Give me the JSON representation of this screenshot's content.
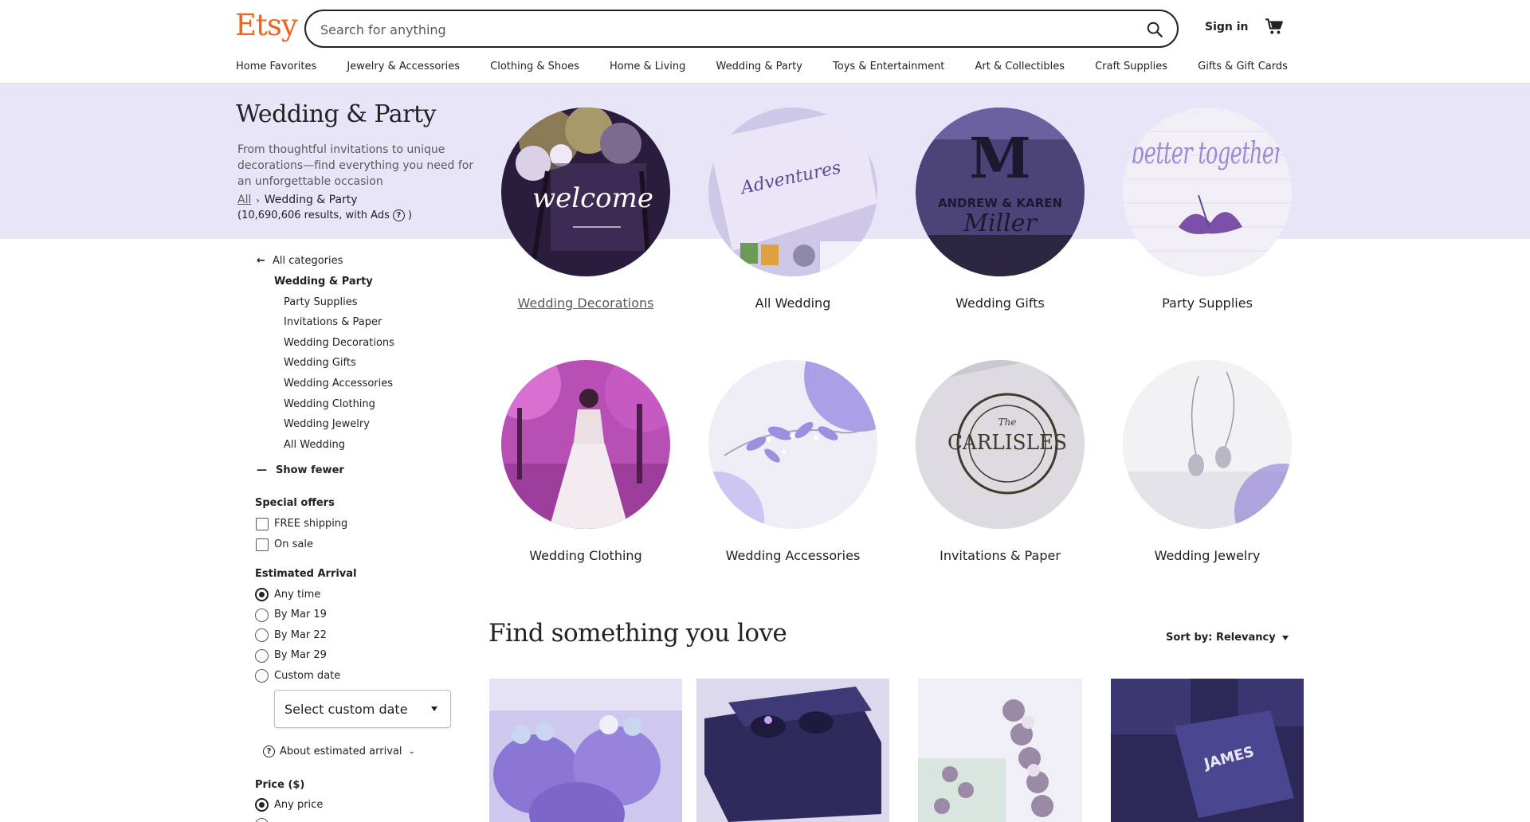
{
  "header": {
    "logo": "Etsy",
    "search_placeholder": "Search for anything",
    "sign_in": "Sign in",
    "cart_icon": "cart-icon",
    "search_icon": "search-icon"
  },
  "category_nav": [
    "Home Favorites",
    "Jewelry & Accessories",
    "Clothing & Shoes",
    "Home & Living",
    "Wedding & Party",
    "Toys & Entertainment",
    "Art & Collectibles",
    "Craft Supplies",
    "Gifts & Gift Cards"
  ],
  "hero": {
    "title": "Wedding & Party",
    "description": "From thoughtful invitations to unique decorations—find everything you need for an unforgettable occasion",
    "breadcrumb_root": "All",
    "breadcrumb_current": "Wedding & Party",
    "results_text": "(10,690,606 results, with Ads",
    "results_close": ")",
    "help_glyph": "?",
    "background": "#e8e5f8"
  },
  "categories": [
    {
      "label": "Wedding Decorations",
      "image_text": "welcome"
    },
    {
      "label": "All Wedding",
      "image_text": "Adventures"
    },
    {
      "label": "Wedding Gifts",
      "image_text": "Miller"
    },
    {
      "label": "Party Supplies",
      "image_text": "better together"
    },
    {
      "label": "Wedding Clothing",
      "image_text": ""
    },
    {
      "label": "Wedding Accessories",
      "image_text": ""
    },
    {
      "label": "Invitations & Paper",
      "image_text": "CARLISLES"
    },
    {
      "label": "Wedding Jewelry",
      "image_text": ""
    }
  ],
  "sidebar": {
    "back_label": "All categories",
    "current_category": "Wedding & Party",
    "subcategories": [
      "Party Supplies",
      "Invitations & Paper",
      "Wedding Decorations",
      "Wedding Gifts",
      "Wedding Accessories",
      "Wedding Clothing",
      "Wedding Jewelry",
      "All Wedding"
    ],
    "show_fewer": "Show fewer",
    "special_offers": {
      "heading": "Special offers",
      "options": [
        "FREE shipping",
        "On sale"
      ]
    },
    "estimated_arrival": {
      "heading": "Estimated Arrival",
      "options": [
        "Any time",
        "By Mar 19",
        "By Mar 22",
        "By Mar 29",
        "Custom date"
      ],
      "selected": "Any time",
      "custom_date_placeholder": "Select custom date",
      "about_label": "About estimated arrival"
    },
    "price": {
      "heading": "Price ($)",
      "options": [
        "Any price"
      ],
      "selected": "Any price"
    }
  },
  "main": {
    "find_title": "Find something you love",
    "sort_label": "Sort by: Relevancy"
  },
  "colors": {
    "accent": "#f1641e",
    "hero_bg": "#e8e5f8",
    "text": "#222222",
    "muted": "#595959",
    "photo_tint": "#7b5fd4"
  }
}
